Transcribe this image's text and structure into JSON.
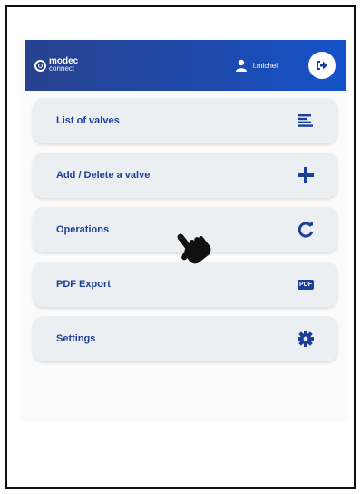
{
  "colors": {
    "header_start": "#27428f",
    "header_end": "#1552c9",
    "menu_bg": "#ebeff2",
    "accent": "#1c3f9b"
  },
  "header": {
    "logo_brand": "modec",
    "logo_sub": "connect",
    "username": "l.michel",
    "logout_icon": "logout-icon"
  },
  "menu": {
    "items": [
      {
        "label": "List of valves",
        "icon": "list-icon"
      },
      {
        "label": "Add / Delete a valve",
        "icon": "plus-icon"
      },
      {
        "label": "Operations",
        "icon": "refresh-icon"
      },
      {
        "label": "PDF Export",
        "icon": "pdf-icon",
        "badge": "PDF"
      },
      {
        "label": "Settings",
        "icon": "gear-icon"
      }
    ]
  },
  "cursor": {
    "icon": "hand-pointer-icon"
  }
}
